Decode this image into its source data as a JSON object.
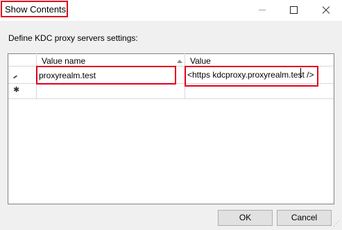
{
  "window": {
    "title": "Show Contents"
  },
  "instructions": "Define KDC proxy servers settings:",
  "table": {
    "columns": [
      "Value name",
      "Value"
    ],
    "rows": [
      {
        "name": "proxyrealm.test",
        "value": "<https kdcproxy.proxyrealm.test />",
        "state": "editing"
      },
      {
        "name": "",
        "value": "",
        "state": "new"
      }
    ]
  },
  "buttons": {
    "ok": "OK",
    "cancel": "Cancel"
  },
  "highlight_color": "#e0001b"
}
